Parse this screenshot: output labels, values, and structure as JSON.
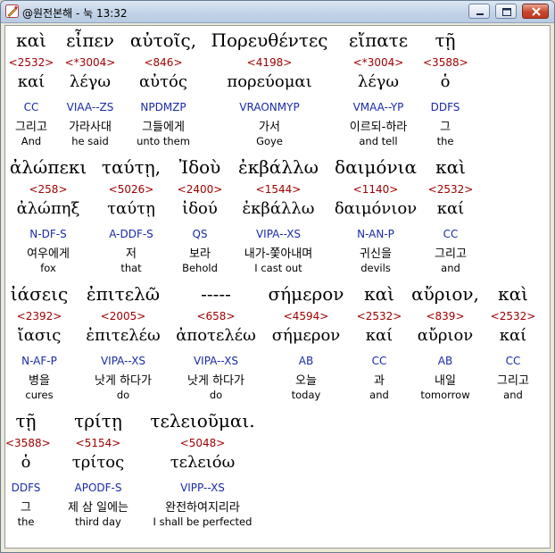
{
  "window": {
    "title": "@원전본해 - 눅 13:32",
    "icon": "pencil-app-icon"
  },
  "rows": [
    {
      "words": [
        {
          "greek": "καὶ",
          "strong": "<2532>",
          "lemma": "καί",
          "parse": "CC",
          "korean": "그리고",
          "english": "And"
        },
        {
          "greek": "εἶπεν",
          "strong": "<*3004>",
          "lemma": "λέγω",
          "parse": "VIAA--ZS",
          "korean": "가라사대",
          "english": "he said"
        },
        {
          "greek": "αὐτοῖς,",
          "strong": "<846>",
          "lemma": "αὐτός",
          "parse": "NPDMZP",
          "korean": "그들에게",
          "english": "unto them"
        },
        {
          "greek": "Πορευθέντες",
          "strong": "<4198>",
          "lemma": "πορεύομαι",
          "parse": "VRAONMYP",
          "korean": "가서",
          "english": "Goye"
        },
        {
          "greek": "εἴπατε",
          "strong": "<*3004>",
          "lemma": "λέγω",
          "parse": "VMAA--YP",
          "korean": "이르되-하라",
          "english": "and tell"
        },
        {
          "greek": "τῇ",
          "strong": "<3588>",
          "lemma": "ὁ",
          "parse": "DDFS",
          "korean": "그",
          "english": "the"
        }
      ]
    },
    {
      "words": [
        {
          "greek": "ἀλώπεκι",
          "strong": "<258>",
          "lemma": "ἀλώπηξ",
          "parse": "N-DF-S",
          "korean": "여우에게",
          "english": "fox"
        },
        {
          "greek": "ταύτῃ,",
          "strong": "<5026>",
          "lemma": "ταύτῃ",
          "parse": "A-DDF-S",
          "korean": "저",
          "english": "that"
        },
        {
          "greek": "Ἰδοὺ",
          "strong": "<2400>",
          "lemma": "ἰδού",
          "parse": "QS",
          "korean": "보라",
          "english": "Behold"
        },
        {
          "greek": "ἐκβάλλω",
          "strong": "<1544>",
          "lemma": "ἐκβάλλω",
          "parse": "VIPA--XS",
          "korean": "내가-쫓아내며",
          "english": "I cast out"
        },
        {
          "greek": "δαιμόνια",
          "strong": "<1140>",
          "lemma": "δαιμόνιον",
          "parse": "N-AN-P",
          "korean": "귀신을",
          "english": "devils"
        },
        {
          "greek": "καὶ",
          "strong": "<2532>",
          "lemma": "καί",
          "parse": "CC",
          "korean": "그리고",
          "english": "and"
        }
      ]
    },
    {
      "words": [
        {
          "greek": "ἰάσεις",
          "strong": "<2392>",
          "lemma": "ἴασις",
          "parse": "N-AF-P",
          "korean": "병을",
          "english": "cures"
        },
        {
          "greek": "ἐπιτελῶ",
          "strong": "<2005>",
          "lemma": "ἐπιτελέω",
          "parse": "VIPA--XS",
          "korean": "낫게 하다가",
          "english": "do"
        },
        {
          "greek": "-----",
          "strong": "<658>",
          "lemma": "ἀποτελέω",
          "parse": "VIPA--XS",
          "korean": "낫게 하다가",
          "english": "do"
        },
        {
          "greek": "σήμερον",
          "strong": "<4594>",
          "lemma": "σήμερον",
          "parse": "AB",
          "korean": "오늘",
          "english": "today"
        },
        {
          "greek": "καὶ",
          "strong": "<2532>",
          "lemma": "καί",
          "parse": "CC",
          "korean": "과",
          "english": "and"
        },
        {
          "greek": "αὔριον,",
          "strong": "<839>",
          "lemma": "αὔριον",
          "parse": "AB",
          "korean": "내일",
          "english": "tomorrow"
        },
        {
          "greek": "καὶ",
          "strong": "<2532>",
          "lemma": "καί",
          "parse": "CC",
          "korean": "그리고",
          "english": "and"
        }
      ]
    },
    {
      "words": [
        {
          "greek": "τῇ",
          "strong": "<3588>",
          "lemma": "ὁ",
          "parse": "DDFS",
          "korean": "그",
          "english": "the"
        },
        {
          "greek": "τρίτῃ",
          "strong": "<5154>",
          "lemma": "τρίτος",
          "parse": "APODF-S",
          "korean": "제 삼 일에는",
          "english": "third day"
        },
        {
          "greek": "τελειοῦμαι.",
          "strong": "<5048>",
          "lemma": "τελειόω",
          "parse": "VIPP--XS",
          "korean": "완전하여지리라",
          "english": "I shall be perfected"
        }
      ]
    }
  ]
}
